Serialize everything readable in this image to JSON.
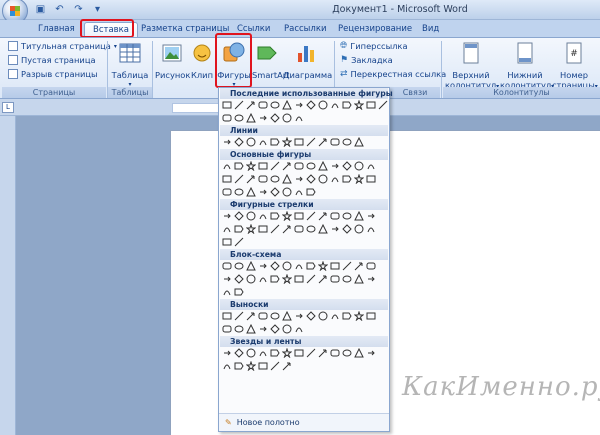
{
  "titlebar": {
    "title": "Документ1 - Microsoft Word"
  },
  "qat": {
    "save_icon": "save-icon",
    "undo_icon": "undo-icon",
    "redo_icon": "redo-icon"
  },
  "tabs": [
    "Главная",
    "Вставка",
    "Разметка страницы",
    "Ссылки",
    "Рассылки",
    "Рецензирование",
    "Вид"
  ],
  "active_tab": "Вставка",
  "ribbon": {
    "pages": {
      "items": [
        "Титульная страница",
        "Пустая страница",
        "Разрыв страницы"
      ],
      "label": "Страницы"
    },
    "tables": {
      "button": "Таблица",
      "label": "Таблицы"
    },
    "illustrations": {
      "picture": "Рисунок",
      "clip": "Клип",
      "shapes": "Фигуры",
      "smartart": "SmartArt",
      "chart": "Диаграмма"
    },
    "links": {
      "items": [
        "Гиперссылка",
        "Закладка",
        "Перекрестная ссылка"
      ],
      "label": "Связи"
    },
    "headers": {
      "header": "Верхний",
      "header2": "колонтитул",
      "footer": "Нижний",
      "footer2": "колонтитул",
      "pagenum": "Номер",
      "pagenum2": "страницы",
      "label": "Колонтитулы"
    }
  },
  "shapes_menu": {
    "sections": [
      "Последние использованные фигуры",
      "Линии",
      "Основные фигуры",
      "Фигурные стрелки",
      "Блок-схема",
      "Выноски",
      "Звезды и ленты"
    ],
    "new_canvas": "Новое полотно"
  },
  "watermark": "КакИменно.ру",
  "colors": {
    "highlight": "#e0141e",
    "ribbon": "#dbe7f7",
    "accent": "#15428b"
  }
}
